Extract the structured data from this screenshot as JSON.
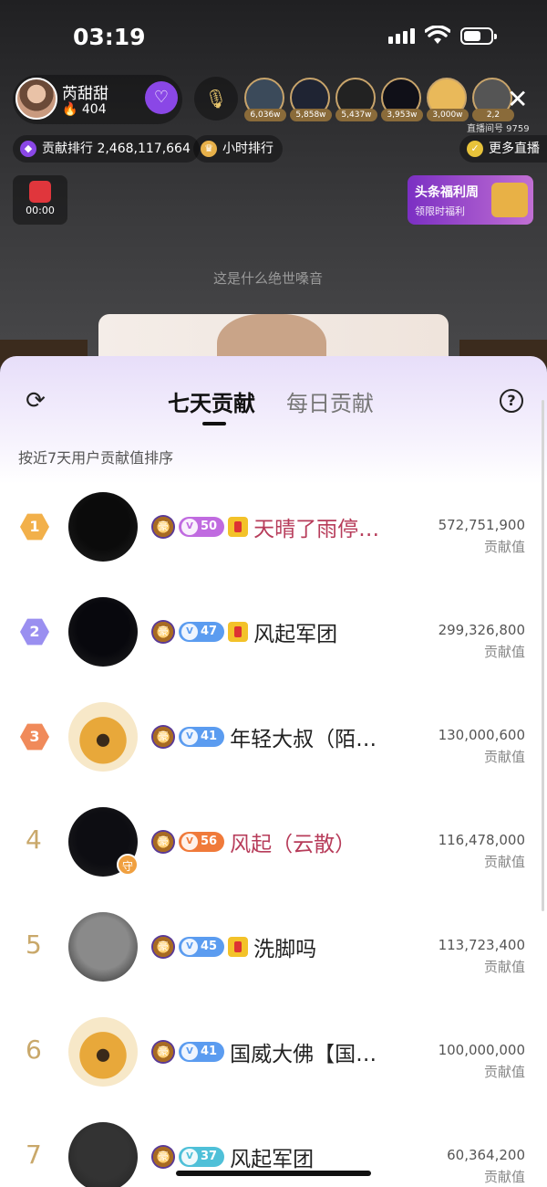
{
  "status_bar": {
    "time": "03:19"
  },
  "host": {
    "name": "芮甜甜",
    "fans": "🔥 404",
    "follow_icon": "heart-wings-icon"
  },
  "viewers": [
    {
      "count": "6,036w",
      "color": "#3b4a5a"
    },
    {
      "count": "5,858w",
      "color": "#1f2433"
    },
    {
      "count": "5,437w",
      "color": "#222222"
    },
    {
      "count": "3,953w",
      "color": "#101018"
    },
    {
      "count": "3,000w",
      "color": "#e9b95a"
    },
    {
      "count": "2,2",
      "color": "#555555"
    }
  ],
  "room": {
    "id_label": "直播间号 9759"
  },
  "toolbar": {
    "contribution_rank": "贡献排行 2,468,117,664",
    "hourly_rank": "小时排行",
    "more_live": "更多直播"
  },
  "redpack": {
    "timer": "00:00"
  },
  "welfare": {
    "title": "头条福利周",
    "subtitle": "领限时福利"
  },
  "danmaku": "这是什么绝世嗓音",
  "panel": {
    "tabs": [
      "七天贡献",
      "每日贡献"
    ],
    "active_tab": 0,
    "subtitle": "按近7天用户贡献值排序",
    "value_label": "贡献值"
  },
  "ranking": [
    {
      "rank": "1",
      "name": "天晴了雨停…",
      "level": "50",
      "level_color": "#c06be0",
      "value": "572,751,900",
      "pink": true,
      "medal": true,
      "avatar": "#0b0b0b",
      "guard": ""
    },
    {
      "rank": "2",
      "name": "风起军团",
      "level": "47",
      "level_color": "#5b9cf0",
      "value": "299,326,800",
      "pink": false,
      "medal": true,
      "avatar": "#08080d",
      "guard": ""
    },
    {
      "rank": "3",
      "name": "年轻大叔（陌…",
      "level": "41",
      "level_color": "#5b9cf0",
      "value": "130,000,600",
      "pink": false,
      "medal": false,
      "avatar": "#f5dfa0",
      "guard": ""
    },
    {
      "rank": "4",
      "name": "风起（云散）",
      "level": "56",
      "level_color": "#f07a3a",
      "value": "116,478,000",
      "pink": true,
      "medal": false,
      "avatar": "#0d0d12",
      "guard": "守"
    },
    {
      "rank": "5",
      "name": "洗脚吗",
      "level": "45",
      "level_color": "#5b9cf0",
      "value": "113,723,400",
      "pink": false,
      "medal": true,
      "avatar": "#8a8a8a",
      "guard": ""
    },
    {
      "rank": "6",
      "name": "国威大佛【国…",
      "level": "41",
      "level_color": "#5b9cf0",
      "value": "100,000,000",
      "pink": false,
      "medal": false,
      "avatar": "#f5dfa0",
      "guard": ""
    },
    {
      "rank": "7",
      "name": "风起军团",
      "level": "37",
      "level_color": "#4fc0d8",
      "value": "60,364,200",
      "pink": false,
      "medal": false,
      "avatar": "#333333",
      "guard": ""
    }
  ],
  "rank_colors": {
    "1": "#f2b04a",
    "2": "#9a8ff0",
    "3": "#f08a5a"
  }
}
